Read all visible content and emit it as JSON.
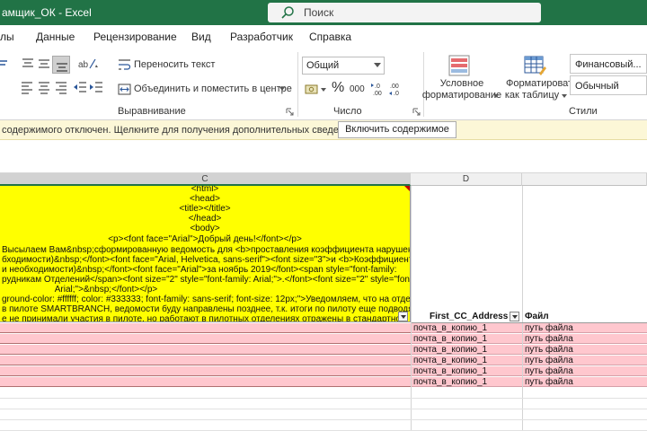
{
  "window": {
    "title": "амщик_ОК  -  Excel",
    "search_placeholder": "Поиск"
  },
  "tabs": [
    "лы",
    "Данные",
    "Рецензирование",
    "Вид",
    "Разработчик",
    "Справка"
  ],
  "ribbon": {
    "wrap_text": "Переносить текст",
    "merge_center": "Объединить и поместить в центре",
    "alignment_label": "Выравнивание",
    "number_format": "Общий",
    "number_label": "Число",
    "conditional_formatting_line1": "Условное",
    "conditional_formatting_line2": "форматирование",
    "format_as_table_line1": "Форматировать",
    "format_as_table_line2": "как таблицу",
    "styles_label": "Стили",
    "style_financial": "Финансовый...",
    "style_normal": "Обычный",
    "percent_symbol": "%",
    "thousands_symbol": "000"
  },
  "message_bar": {
    "text": "содержимого отключен. Щелкните для получения дополнительных сведений.",
    "button": "Включить содержимое"
  },
  "columns": {
    "c": "C",
    "d": "D"
  },
  "yellow_cell": {
    "centered_lines": [
      "<html>",
      "<head>",
      "<title></title>",
      "</head>",
      "<body>",
      "<p><font face=\"Arial\">Добрый день!</font></p>"
    ],
    "lines": [
      "Высылаем Вам&nbsp;сформированную ведомость для <b>проставления коэффициента нарушений",
      "бходимости)&nbsp;</font><font face=\"Arial, Helvetica, sans-serif\"><font size=\"3\">и <b>Коэффициент",
      "и необходимости)&nbsp;</font><font face=\"Arial\">за ноябрь 2019</font><span style=\"font-family:",
      "рудникам Отделений</span><font size=\"2\" style=\"font-family: Arial;\">.</font><font size=\"2\" style=\"font-family:",
      "Arial;\">&nbsp;</font></p>",
      "ground-color: #ffffff; color: #333333; font-family: sans-serif; font-size: 12px;\">Уведомляем, что на отделения,",
      "в пилоте SMARTBRANCH, ведомости буду направлены позднее, т.к. итоги по пилоту еще подводятся.",
      "е не принимали участия в пилоте, но работают в пилотных отделениях отражены в стандартной"
    ]
  },
  "headers": {
    "d": "First_CC_Address",
    "e": "Файл"
  },
  "rows": [
    {
      "d": "почта_в_копию_1",
      "e": "путь файла"
    },
    {
      "d": "почта_в_копию_1",
      "e": "путь файла"
    },
    {
      "d": "почта_в_копию_1",
      "e": "путь файла"
    },
    {
      "d": "почта_в_копию_1",
      "e": "путь файла"
    },
    {
      "d": "почта_в_копию_1",
      "e": "путь файла"
    },
    {
      "d": "почта_в_копию_1",
      "e": "путь файла"
    }
  ],
  "colors": {
    "accent": "#217346",
    "highlight": "#ffff00",
    "pink": "#ffc7ce",
    "message": "#fcf7d7"
  }
}
